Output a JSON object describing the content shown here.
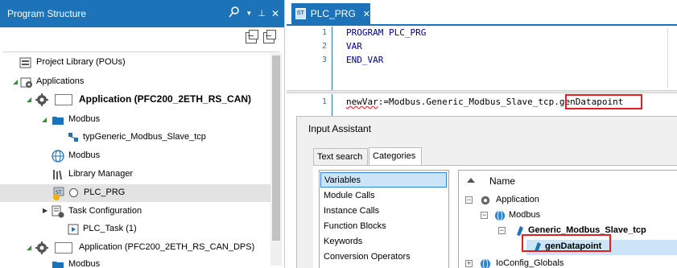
{
  "left_panel": {
    "title": "Program Structure",
    "header_icons": [
      "search-icon",
      "dropdown-arrow-icon",
      "pin-icon",
      "close-icon"
    ],
    "toolbar_icons": [
      "expand-all-icon",
      "collapse-all-icon"
    ],
    "tree": [
      {
        "label": "Project Library (POUs)",
        "icon": "library-icon"
      },
      {
        "label": "Applications",
        "icon": "applications-icon",
        "expanded": true
      },
      {
        "label": "Application (PFC200_2ETH_RS_CAN)",
        "icon": "gear-icon",
        "expanded": true
      },
      {
        "label": "Modbus",
        "icon": "folder-icon",
        "expanded": true
      },
      {
        "label": "typGeneric_Modbus_Slave_tcp",
        "icon": "struct-icon"
      },
      {
        "label": "Modbus",
        "icon": "globe-icon"
      },
      {
        "label": "Library Manager",
        "icon": "library-manager-icon"
      },
      {
        "label": "PLC_PRG",
        "icon": "st-pou-icon",
        "selected": true
      },
      {
        "label": "Task Configuration",
        "icon": "task-config-icon",
        "expanded": false
      },
      {
        "label": "PLC_Task (1)",
        "icon": "task-icon"
      },
      {
        "label": "Application (PFC200_2ETH_RS_CAN_DPS)",
        "icon": "gear-icon",
        "expanded": true
      },
      {
        "label": "Modbus",
        "icon": "folder-icon"
      }
    ]
  },
  "editor": {
    "tab_label": "PLC_PRG",
    "tab_badge": "ST",
    "declaration": [
      {
        "num": "1",
        "text": "PROGRAM PLC_PRG"
      },
      {
        "num": "2",
        "text": "VAR"
      },
      {
        "num": "3",
        "text": "END_VAR"
      }
    ],
    "implementation": {
      "num": "1",
      "prefix": "newVar",
      "middle": ":=Modbus.Generic_Modbus_Slave_tcp.",
      "highlight": "genDatapoint"
    }
  },
  "input_assistant": {
    "title": "Input Assistant",
    "tabs": [
      "Text search",
      "Categories"
    ],
    "active_tab": "Categories",
    "categories": [
      "Variables",
      "Module Calls",
      "Instance Calls",
      "Function Blocks",
      "Keywords",
      "Conversion Operators"
    ],
    "selected_category": "Variables",
    "column_header": "Name",
    "tree": [
      {
        "label": "Application",
        "icon": "gear-icon",
        "expanded": true
      },
      {
        "label": "Modbus",
        "icon": "globe-icon",
        "expanded": true
      },
      {
        "label": "Generic_Modbus_Slave_tcp",
        "icon": "variable-icon",
        "expanded": true
      },
      {
        "label": "genDatapoint",
        "icon": "variable-icon",
        "selected": true
      },
      {
        "label": "IoConfig_Globals",
        "icon": "globe-icon",
        "expanded": false
      }
    ]
  },
  "colors": {
    "accent": "#1c73b8",
    "highlight_box": "#e02020",
    "selection": "#cce4f7",
    "keyword": "#00008b"
  }
}
